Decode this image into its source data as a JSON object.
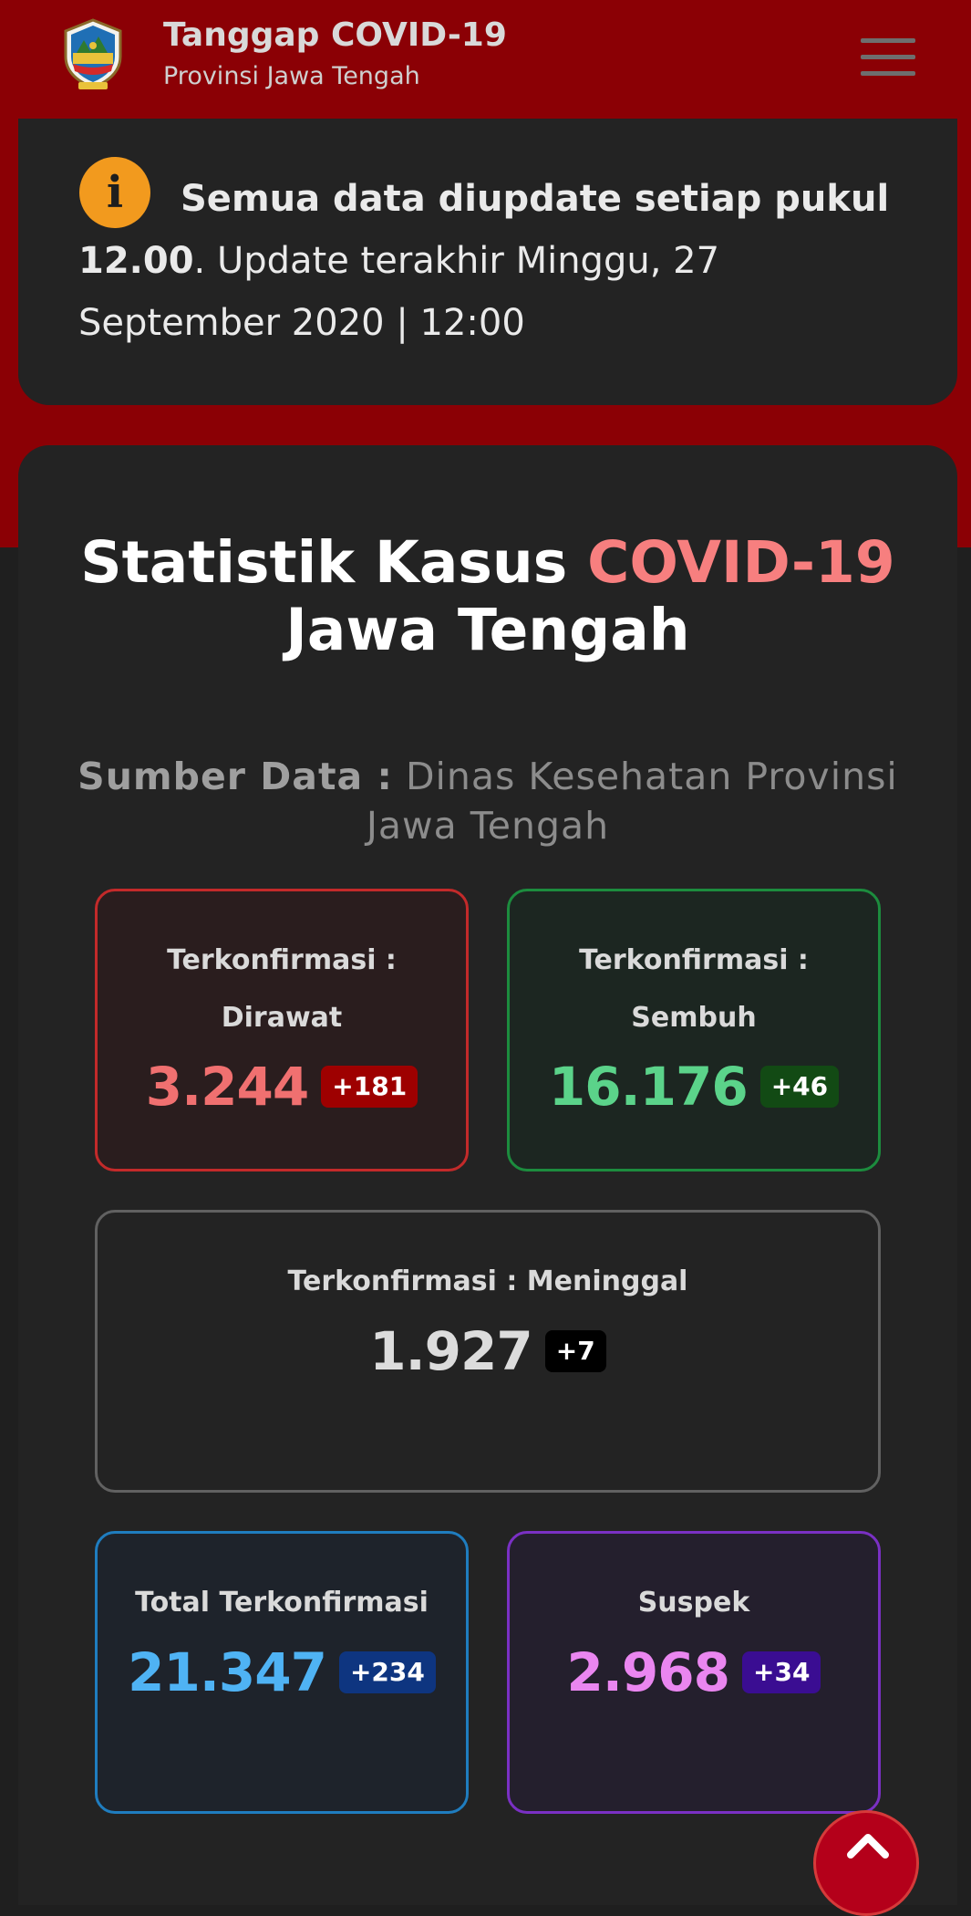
{
  "colors": {
    "brand_red": "#8b0005",
    "card_bg": "#232323",
    "info_icon": "#f29a1e",
    "accent": "#f77f7f"
  },
  "header": {
    "logo_icon": "jawa-tengah-emblem-icon",
    "title": "Tanggap COVID-19",
    "subtitle": "Provinsi Jawa Tengah",
    "menu_icon": "hamburger-menu-icon"
  },
  "notice": {
    "icon": "i",
    "lead": "Semua data diupdate setiap pukul",
    "time_bold": "12.00",
    "rest": ". Update terakhir Minggu, 27 September 2020 | 12:00"
  },
  "stats": {
    "title_part1": "Statistik Kasus ",
    "title_accent": "COVID-19",
    "title_part2": "Jawa Tengah",
    "source_label": "Sumber Data :",
    "source_value": " Dinas Kesehatan Provinsi Jawa Tengah",
    "cards": {
      "dirawat": {
        "label_line1": "Terkonfirmasi :",
        "label_line2": "Dirawat",
        "value": "3.244",
        "delta": "+181",
        "color": "#f07070"
      },
      "sembuh": {
        "label_line1": "Terkonfirmasi :",
        "label_line2": "Sembuh",
        "value": "16.176",
        "delta": "+46",
        "color": "#5bd38a"
      },
      "meninggal": {
        "label": "Terkonfirmasi : Meninggal",
        "value": "1.927",
        "delta": "+7",
        "color": "#dcdcdc"
      },
      "total": {
        "label": "Total Terkonfirmasi",
        "value": "21.347",
        "delta": "+234",
        "color": "#4fb3f4"
      },
      "suspek": {
        "label": "Suspek",
        "value": "2.968",
        "delta": "+34",
        "color": "#ea86f0"
      }
    }
  },
  "scroll_top_icon": "chevron-up-icon"
}
